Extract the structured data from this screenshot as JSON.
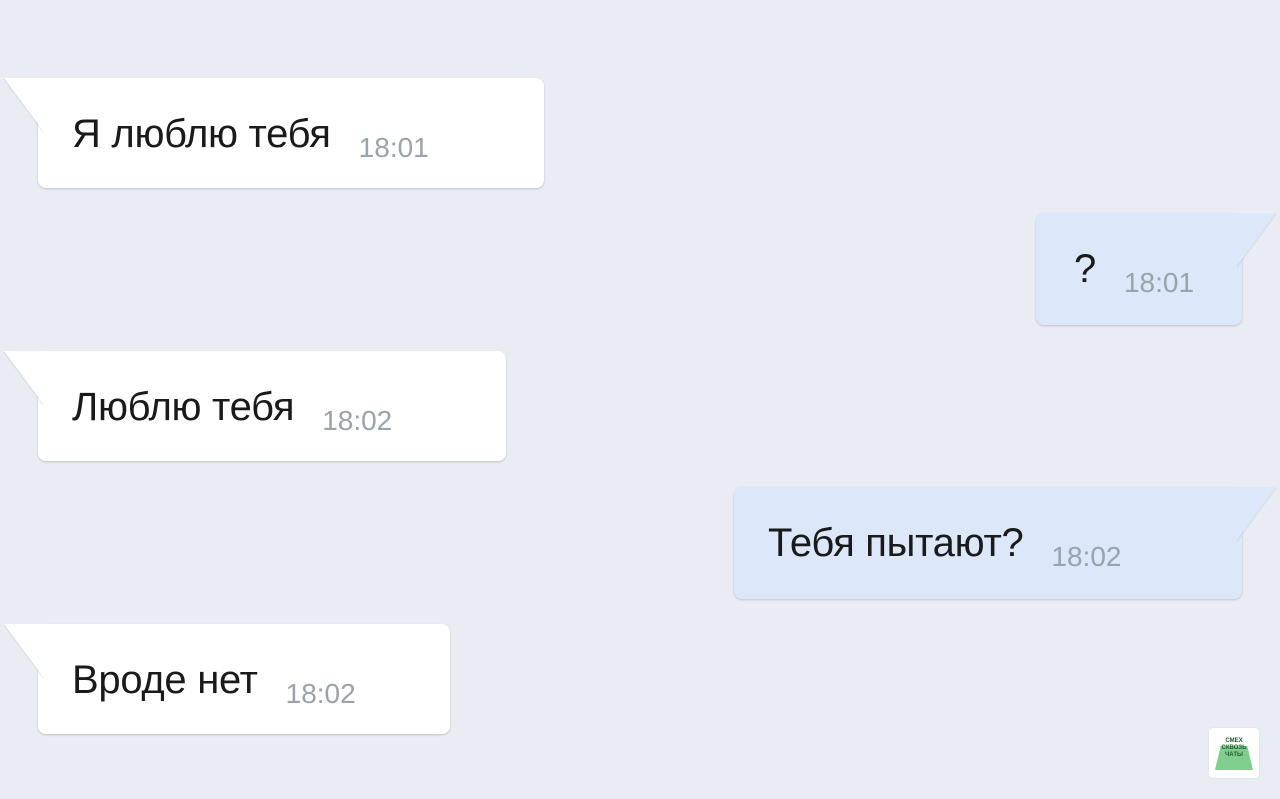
{
  "chat": {
    "messages": [
      {
        "direction": "incoming",
        "text": "Я люблю тебя",
        "time": "18:01"
      },
      {
        "direction": "outgoing",
        "text": "?",
        "time": "18:01"
      },
      {
        "direction": "incoming",
        "text": "Люблю тебя",
        "time": "18:02"
      },
      {
        "direction": "outgoing",
        "text": "Тебя пытают?",
        "time": "18:02"
      },
      {
        "direction": "incoming",
        "text": "Вроде нет",
        "time": "18:02"
      }
    ]
  },
  "watermark": {
    "lines": [
      "СМЕХ",
      "СКВОЗЬ",
      "ЧАТЫ"
    ]
  },
  "colors": {
    "background": "#e9edf3",
    "incoming_bubble": "#ffffff",
    "outgoing_bubble": "#dce7f9",
    "message_text": "#1a1a1a",
    "time_text": "#9aa2ab"
  }
}
